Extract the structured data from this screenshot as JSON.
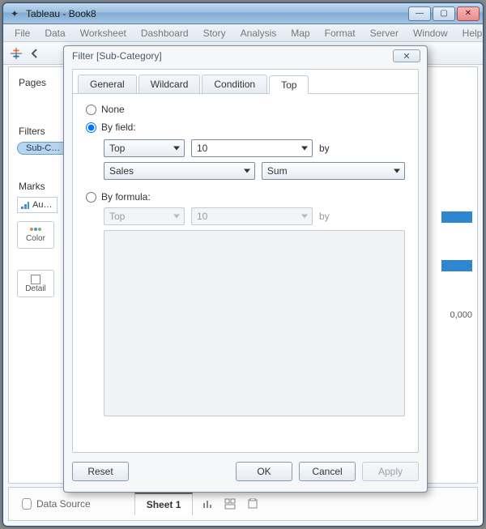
{
  "window": {
    "title": "Tableau - Book8",
    "controls": {
      "min": "—",
      "max": "▢",
      "close": "✕"
    }
  },
  "menu": {
    "items": [
      "File",
      "Data",
      "Worksheet",
      "Dashboard",
      "Story",
      "Analysis",
      "Map",
      "Format",
      "Server",
      "Window",
      "Help"
    ]
  },
  "panels": {
    "pages": "Pages",
    "filters": "Filters",
    "filter_pill": "Sub-C…",
    "marks": "Marks",
    "marks_type": "Au…",
    "shelf_color": "Color",
    "shelf_detail": "Detail"
  },
  "viz": {
    "axis_tick": "0,000"
  },
  "bottom": {
    "data_source": "Data Source",
    "sheet": "Sheet 1"
  },
  "dialog": {
    "title": "Filter [Sub-Category]",
    "close": "✕",
    "tabs": {
      "general": "General",
      "wildcard": "Wildcard",
      "condition": "Condition",
      "top": "Top"
    },
    "active_tab": "top",
    "top": {
      "opt_none": "None",
      "opt_by_field": "By field:",
      "opt_by_formula": "By formula:",
      "by_label": "by",
      "field_direction": "Top",
      "field_count": "10",
      "field_measure": "Sales",
      "field_agg": "Sum",
      "formula_direction": "Top",
      "formula_count": "10"
    },
    "buttons": {
      "reset": "Reset",
      "ok": "OK",
      "cancel": "Cancel",
      "apply": "Apply"
    }
  }
}
